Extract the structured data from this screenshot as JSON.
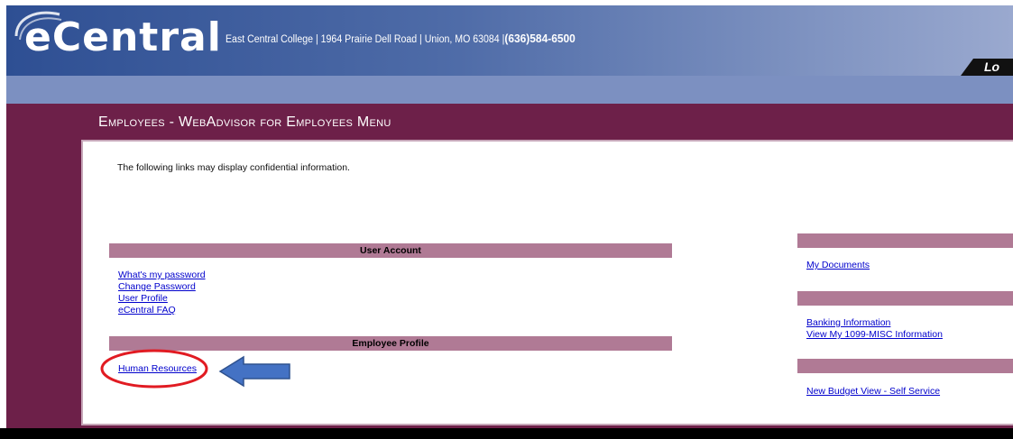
{
  "header": {
    "brand": "eCentral",
    "tagline": "East Central College | 1964 Prairie Dell Road | Union, MO 63084 |",
    "phone": "(636)584-6500",
    "logout_label": "Lo"
  },
  "page": {
    "title": "Employees - WebAdvisor for Employees Menu",
    "notice": "The following links may display confidential information."
  },
  "left_sections": [
    {
      "title": "User Account",
      "links": [
        "What's my password",
        "Change Password",
        "User Profile",
        "eCentral FAQ"
      ]
    },
    {
      "title": "Employee Profile",
      "links": [
        "Human Resources"
      ]
    }
  ],
  "right_sections": [
    {
      "title": "",
      "links": [
        "My Documents"
      ]
    },
    {
      "title": "",
      "links": [
        "Banking Information",
        "View My 1099-MISC Information"
      ]
    },
    {
      "title": "",
      "links": [
        "New Budget View - Self Service"
      ]
    }
  ],
  "annotations": {
    "ellipse_color": "#e11b22",
    "arrow_color": "#4472c4"
  },
  "colors": {
    "header_blue": "#2e4f93",
    "maroon": "#6d2049",
    "section_bar": "#b07a95",
    "link": "#0000cc"
  }
}
